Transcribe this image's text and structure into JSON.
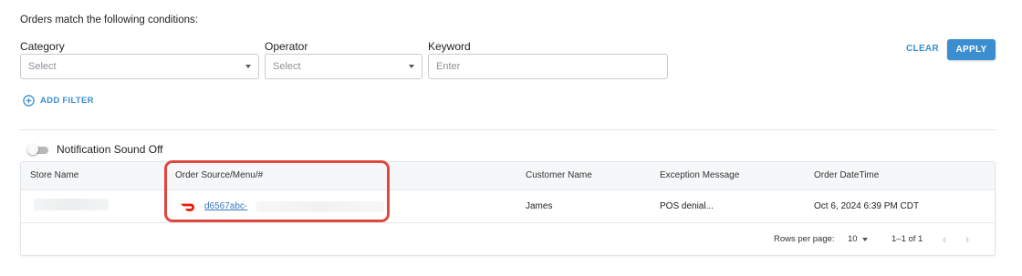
{
  "filters": {
    "intro": "Orders match the following conditions:",
    "category": {
      "label": "Category",
      "placeholder": "Select"
    },
    "operator": {
      "label": "Operator",
      "placeholder": "Select"
    },
    "keyword": {
      "label": "Keyword",
      "placeholder": "Enter"
    },
    "clear_label": "CLEAR",
    "apply_label": "APPLY",
    "add_filter_label": "ADD FILTER"
  },
  "notification": {
    "label": "Notification Sound Off",
    "enabled": false
  },
  "table": {
    "columns": [
      "Store Name",
      "Order Source/Menu/#",
      "Customer Name",
      "Exception Message",
      "Order DateTime"
    ],
    "rows": [
      {
        "store_name": "",
        "source_icon": "doordash-icon",
        "order_id": "d6567abc-",
        "customer_name": "James",
        "exception_message": "POS denial...",
        "order_datetime": "Oct 6, 2024 6:39 PM CDT"
      }
    ]
  },
  "pagination": {
    "rows_per_page_label": "Rows per page:",
    "rows_per_page_value": "10",
    "range": "1–1 of 1"
  },
  "colors": {
    "accent": "#3b8ed0",
    "highlight": "#e0483f",
    "doordash": "#eb1700"
  }
}
